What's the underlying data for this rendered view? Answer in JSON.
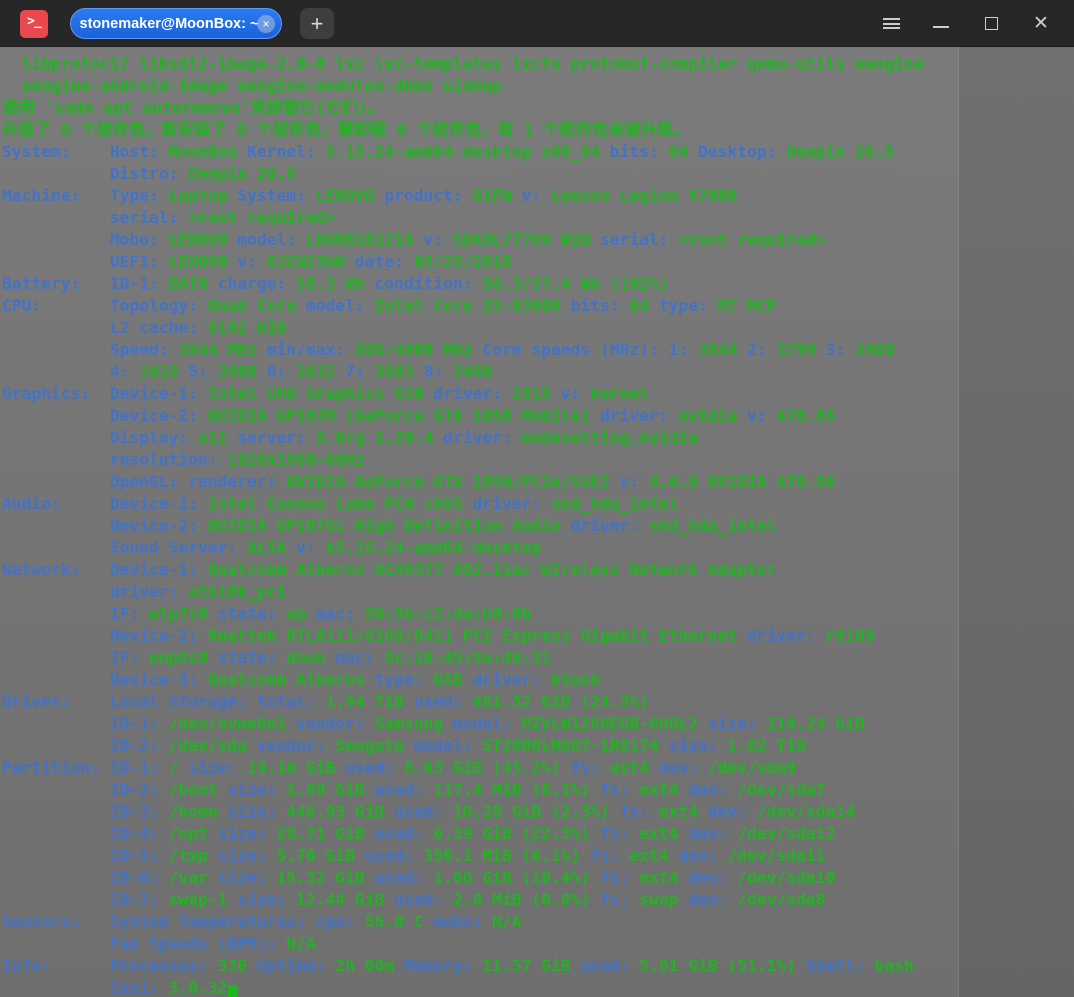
{
  "colors": {
    "key_blue": "#4273c8",
    "value_green": "#21b421",
    "tab_blue": "#2172eb",
    "app_icon_red": "#e8484e",
    "titlebar_bg": "#272727",
    "terminal_bg": "#767676",
    "control_gray": "#cccccc"
  },
  "titlebar": {
    "tab_title": "stonemaker@MoonBox: ~"
  },
  "icons": {
    "app_glyph": ">_",
    "tab_close": "×",
    "new_tab": "+",
    "menu": "hamburger-menu",
    "minimize": "minimize-bar",
    "maximize": "maximize-square",
    "close": "✕"
  },
  "terminal": {
    "lines": [
      [
        [
          "  libprotoc17 libsdl2-image-2.0-0 lxc lxc-templates lxcfs protobuf-compiler qemu-utils uengine",
          "v"
        ]
      ],
      [
        [
          "  uengine-android-image uengine-modules-dkms uidmap",
          "v"
        ]
      ],
      [
        [
          "使用 'sudo apt autoremove'来卸载它(它们)。",
          "v"
        ]
      ],
      [
        [
          "升级了 0 个软件包，新安装了 0 个软件包，要卸载 0 个软件包，有 1 个软件包未被升级。",
          "v"
        ]
      ],
      [
        [
          "System:    Host: ",
          "k"
        ],
        [
          "MoonBox ",
          "v"
        ],
        [
          "Kernel: ",
          "k"
        ],
        [
          "5.15.24-amd64-desktop x86_64 ",
          "v"
        ],
        [
          "bits: ",
          "k"
        ],
        [
          "64 ",
          "v"
        ],
        [
          "Desktop: ",
          "k"
        ],
        [
          "Deepin 20.5",
          "v"
        ]
      ],
      [
        [
          "           Distro: ",
          "k"
        ],
        [
          "Deepin 20.5",
          "v"
        ]
      ],
      [
        [
          "Machine:   Type: ",
          "k"
        ],
        [
          "Laptop ",
          "v"
        ],
        [
          "System: ",
          "k"
        ],
        [
          "LENOVO ",
          "v"
        ],
        [
          "product: ",
          "k"
        ],
        [
          "81FW ",
          "v"
        ],
        [
          "v: ",
          "k"
        ],
        [
          "Lenovo Legion Y7000",
          "v"
        ]
      ],
      [
        [
          "           serial: ",
          "k"
        ],
        [
          "<root required>",
          "v"
        ]
      ],
      [
        [
          "           Mobo: ",
          "k"
        ],
        [
          "LENOVO ",
          "v"
        ],
        [
          "model: ",
          "k"
        ],
        [
          "LNVNB161216 ",
          "v"
        ],
        [
          "v: ",
          "k"
        ],
        [
          "SDK0L77769 WIN ",
          "v"
        ],
        [
          "serial: ",
          "k"
        ],
        [
          "<root required>",
          "v"
        ]
      ],
      [
        [
          "           UEFI: ",
          "k"
        ],
        [
          "LENOVO ",
          "v"
        ],
        [
          "v: ",
          "k"
        ],
        [
          "8JCN23WW ",
          "v"
        ],
        [
          "date: ",
          "k"
        ],
        [
          "05/25/2018",
          "v"
        ]
      ],
      [
        [
          "Battery:   ID-1: ",
          "k"
        ],
        [
          "BAT0 ",
          "v"
        ],
        [
          "charge: ",
          "k"
        ],
        [
          "58.3 Wh ",
          "v"
        ],
        [
          "condition: ",
          "k"
        ],
        [
          "58.3/57.4 Wh (102%)",
          "v"
        ]
      ],
      [
        [
          "CPU:       Topology: ",
          "k"
        ],
        [
          "Quad Core ",
          "v"
        ],
        [
          "model: ",
          "k"
        ],
        [
          "Intel Core i5-8300H ",
          "v"
        ],
        [
          "bits: ",
          "k"
        ],
        [
          "64 ",
          "v"
        ],
        [
          "type: ",
          "k"
        ],
        [
          "MT MCP",
          "v"
        ]
      ],
      [
        [
          "           L2 cache: ",
          "k"
        ],
        [
          "8192 KiB",
          "v"
        ]
      ],
      [
        [
          "           Speed: ",
          "k"
        ],
        [
          "3844 MHz ",
          "v"
        ],
        [
          "min/max: ",
          "k"
        ],
        [
          "800/4000 MHz ",
          "v"
        ],
        [
          "Core speeds (MHz): 1: ",
          "k"
        ],
        [
          "3844 ",
          "v"
        ],
        [
          "2: ",
          "k"
        ],
        [
          "3799 ",
          "v"
        ],
        [
          "3: ",
          "k"
        ],
        [
          "3900",
          "v"
        ]
      ],
      [
        [
          "           4: ",
          "k"
        ],
        [
          "3418 ",
          "v"
        ],
        [
          "5: ",
          "k"
        ],
        [
          "3900 ",
          "v"
        ],
        [
          "6: ",
          "k"
        ],
        [
          "3832 ",
          "v"
        ],
        [
          "7: ",
          "k"
        ],
        [
          "3803 ",
          "v"
        ],
        [
          "8: ",
          "k"
        ],
        [
          "3460",
          "v"
        ]
      ],
      [
        [
          "Graphics:  Device-1: ",
          "k"
        ],
        [
          "Intel UHD Graphics 630 ",
          "v"
        ],
        [
          "driver: ",
          "k"
        ],
        [
          "i915 ",
          "v"
        ],
        [
          "v: ",
          "k"
        ],
        [
          "kernel",
          "v"
        ]
      ],
      [
        [
          "           Device-2: ",
          "k"
        ],
        [
          "NVIDIA GP107M [GeForce GTX 1050 Mobile] ",
          "v"
        ],
        [
          "driver: ",
          "k"
        ],
        [
          "nvidia ",
          "v"
        ],
        [
          "v: ",
          "k"
        ],
        [
          "470.86",
          "v"
        ]
      ],
      [
        [
          "           Display: ",
          "k"
        ],
        [
          "x11 ",
          "v"
        ],
        [
          "server: ",
          "k"
        ],
        [
          "X.Org 1.20.4 ",
          "v"
        ],
        [
          "driver: ",
          "k"
        ],
        [
          "modesetting,nvidia",
          "v"
        ]
      ],
      [
        [
          "           resolution: ",
          "k"
        ],
        [
          "1920x1080~60Hz",
          "v"
        ]
      ],
      [
        [
          "           OpenGL: renderer: ",
          "k"
        ],
        [
          "NVIDIA GeForce GTX 1050/PCIe/SSE2 ",
          "v"
        ],
        [
          "v: ",
          "k"
        ],
        [
          "4.6.0 NVIDIA 470.86",
          "v"
        ]
      ],
      [
        [
          "Audio:     Device-1: ",
          "k"
        ],
        [
          "Intel Cannon Lake PCH cAVS ",
          "v"
        ],
        [
          "driver: ",
          "k"
        ],
        [
          "snd_hda_intel",
          "v"
        ]
      ],
      [
        [
          "           Device-2: ",
          "k"
        ],
        [
          "NVIDIA GP107GL High Definition Audio ",
          "v"
        ],
        [
          "driver: ",
          "k"
        ],
        [
          "snd_hda_intel",
          "v"
        ]
      ],
      [
        [
          "           Sound Server: ",
          "k"
        ],
        [
          "ALSA ",
          "v"
        ],
        [
          "v: ",
          "k"
        ],
        [
          "k5.15.24-amd64-desktop",
          "v"
        ]
      ],
      [
        [
          "Network:   Device-1: ",
          "k"
        ],
        [
          "Qualcomm Atheros QCA9377 802.11ac Wireless Network Adapter",
          "v"
        ]
      ],
      [
        [
          "           driver: ",
          "k"
        ],
        [
          "ath10k_pci",
          "v"
        ]
      ],
      [
        [
          "           IF: ",
          "k"
        ],
        [
          "wlp7s0 ",
          "v"
        ],
        [
          "state: ",
          "k"
        ],
        [
          "up ",
          "v"
        ],
        [
          "mac: ",
          "k"
        ],
        [
          "50:5b:c2:da:b9:0b",
          "v"
        ]
      ],
      [
        [
          "           Device-2: ",
          "k"
        ],
        [
          "Realtek RTL8111/8168/8411 PCI Express Gigabit Ethernet ",
          "v"
        ],
        [
          "driver: ",
          "k"
        ],
        [
          "r8169",
          "v"
        ]
      ],
      [
        [
          "           IF: ",
          "k"
        ],
        [
          "enp8s0 ",
          "v"
        ],
        [
          "state: ",
          "k"
        ],
        [
          "down ",
          "v"
        ],
        [
          "mac: ",
          "k"
        ],
        [
          "8c:16:45:8e:46:31",
          "v"
        ]
      ],
      [
        [
          "           Device-3: ",
          "k"
        ],
        [
          "Qualcomm Atheros ",
          "v"
        ],
        [
          "type: ",
          "k"
        ],
        [
          "USB ",
          "v"
        ],
        [
          "driver: ",
          "k"
        ],
        [
          "btusb",
          "v"
        ]
      ],
      [
        [
          "Drives:    Local Storage: total: ",
          "k"
        ],
        [
          "1.94 TiB ",
          "v"
        ],
        [
          "used: ",
          "k"
        ],
        [
          "481.52 GiB (24.3%)",
          "v"
        ]
      ],
      [
        [
          "           ID-1: ",
          "k"
        ],
        [
          "/dev/nvme0n1 ",
          "v"
        ],
        [
          "vendor: ",
          "k"
        ],
        [
          "Samsung ",
          "v"
        ],
        [
          "model: ",
          "k"
        ],
        [
          "MZVLW128HEGR-000L2 ",
          "v"
        ],
        [
          "size: ",
          "k"
        ],
        [
          "119.24 GiB",
          "v"
        ]
      ],
      [
        [
          "           ID-2: ",
          "k"
        ],
        [
          "/dev/sda ",
          "v"
        ],
        [
          "vendor: ",
          "k"
        ],
        [
          "Seagate ",
          "v"
        ],
        [
          "model: ",
          "k"
        ],
        [
          "ST2000LM007-1R8174 ",
          "v"
        ],
        [
          "size: ",
          "k"
        ],
        [
          "1.82 TiB",
          "v"
        ]
      ],
      [
        [
          "Partition: ID-1: ",
          "k"
        ],
        [
          "/ ",
          "v"
        ],
        [
          "size: ",
          "k"
        ],
        [
          "19.10 GiB ",
          "v"
        ],
        [
          "used: ",
          "k"
        ],
        [
          "8.63 GiB (45.2%) ",
          "v"
        ],
        [
          "fs: ",
          "k"
        ],
        [
          "ext4 ",
          "v"
        ],
        [
          "dev: ",
          "k"
        ],
        [
          "/dev/sda9",
          "v"
        ]
      ],
      [
        [
          "           ID-2: ",
          "k"
        ],
        [
          "/boot ",
          "v"
        ],
        [
          "size: ",
          "k"
        ],
        [
          "1.89 GiB ",
          "v"
        ],
        [
          "used: ",
          "k"
        ],
        [
          "117.4 MiB (6.1%) ",
          "v"
        ],
        [
          "fs: ",
          "k"
        ],
        [
          "ext4 ",
          "v"
        ],
        [
          "dev: ",
          "k"
        ],
        [
          "/dev/sda7",
          "v"
        ]
      ],
      [
        [
          "           ID-3: ",
          "k"
        ],
        [
          "/home ",
          "v"
        ],
        [
          "size: ",
          "k"
        ],
        [
          "446.93 GiB ",
          "v"
        ],
        [
          "used: ",
          "k"
        ],
        [
          "10.28 GiB (2.3%) ",
          "v"
        ],
        [
          "fs: ",
          "k"
        ],
        [
          "ext4 ",
          "v"
        ],
        [
          "dev: ",
          "k"
        ],
        [
          "/dev/sda14",
          "v"
        ]
      ],
      [
        [
          "           ID-4: ",
          "k"
        ],
        [
          "/opt ",
          "v"
        ],
        [
          "size: ",
          "k"
        ],
        [
          "28.71 GiB ",
          "v"
        ],
        [
          "used: ",
          "k"
        ],
        [
          "6.39 GiB (22.3%) ",
          "v"
        ],
        [
          "fs: ",
          "k"
        ],
        [
          "ext4 ",
          "v"
        ],
        [
          "dev: ",
          "k"
        ],
        [
          "/dev/sda12",
          "v"
        ]
      ],
      [
        [
          "           ID-5: ",
          "k"
        ],
        [
          "/tmp ",
          "v"
        ],
        [
          "size: ",
          "k"
        ],
        [
          "5.70 GiB ",
          "v"
        ],
        [
          "used: ",
          "k"
        ],
        [
          "356.1 MiB (6.1%) ",
          "v"
        ],
        [
          "fs: ",
          "k"
        ],
        [
          "ext4 ",
          "v"
        ],
        [
          "dev: ",
          "k"
        ],
        [
          "/dev/sda11",
          "v"
        ]
      ],
      [
        [
          "           ID-6: ",
          "k"
        ],
        [
          "/var ",
          "v"
        ],
        [
          "size: ",
          "k"
        ],
        [
          "15.32 GiB ",
          "v"
        ],
        [
          "used: ",
          "k"
        ],
        [
          "1.60 GiB (10.4%) ",
          "v"
        ],
        [
          "fs: ",
          "k"
        ],
        [
          "ext4 ",
          "v"
        ],
        [
          "dev: ",
          "k"
        ],
        [
          "/dev/sda10",
          "v"
        ]
      ],
      [
        [
          "           ID-7: ",
          "k"
        ],
        [
          "swap-1 ",
          "v"
        ],
        [
          "size: ",
          "k"
        ],
        [
          "12.44 GiB ",
          "v"
        ],
        [
          "used: ",
          "k"
        ],
        [
          "2.0 MiB (0.0%) ",
          "v"
        ],
        [
          "fs: ",
          "k"
        ],
        [
          "swap ",
          "v"
        ],
        [
          "dev: ",
          "k"
        ],
        [
          "/dev/sda8",
          "v"
        ]
      ],
      [
        [
          "Sensors:   System Temperatures: cpu: ",
          "k"
        ],
        [
          "56.0 C ",
          "v"
        ],
        [
          "mobo: ",
          "k"
        ],
        [
          "N/A",
          "v"
        ]
      ],
      [
        [
          "           Fan Speeds (RPM): ",
          "k"
        ],
        [
          "N/A",
          "v"
        ]
      ],
      [
        [
          "Info:      Processes: ",
          "k"
        ],
        [
          "336 ",
          "v"
        ],
        [
          "Uptime: ",
          "k"
        ],
        [
          "2h 00m ",
          "v"
        ],
        [
          "Memory: ",
          "k"
        ],
        [
          "11.57 GiB ",
          "v"
        ],
        [
          "used: ",
          "k"
        ],
        [
          "5.91 GiB (51.1%) ",
          "v"
        ],
        [
          "Shell: ",
          "k"
        ],
        [
          "bash",
          "v"
        ]
      ],
      [
        [
          "           inxi: ",
          "k"
        ],
        [
          "3.0.32",
          "v"
        ]
      ]
    ]
  }
}
